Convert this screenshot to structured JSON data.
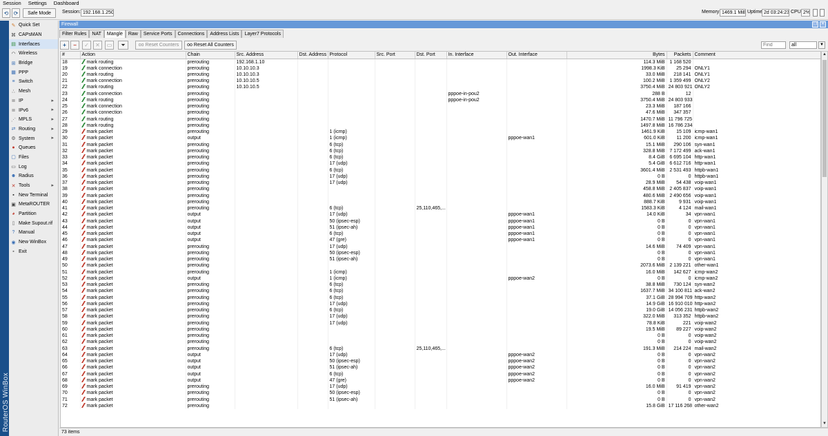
{
  "menubar": {
    "items": [
      "Session",
      "Settings",
      "Dashboard"
    ]
  },
  "toolbar": {
    "safe_mode": "Safe Mode",
    "session_label": "Session:",
    "session_value": "192.168.1.250",
    "memory_label": "Memory:",
    "memory_value": "1469.1 MiB",
    "uptime_label": "Uptime:",
    "uptime_value": "2d 03:24:23",
    "cpu_label": "CPU:",
    "cpu_value": "2%"
  },
  "brand": "RouterOS WinBox",
  "sidebar": {
    "items": [
      {
        "label": "Quick Set",
        "icon": "quickset-icon",
        "glyph": "✎",
        "color": "#d07a2a",
        "submenu": false
      },
      {
        "label": "CAPsMAN",
        "icon": "capsman-icon",
        "glyph": "⌘",
        "color": "#444444",
        "submenu": false
      },
      {
        "label": "Interfaces",
        "icon": "interfaces-icon",
        "glyph": "▤",
        "color": "#2e8b3a",
        "submenu": false
      },
      {
        "label": "Wireless",
        "icon": "wireless-icon",
        "glyph": "◠",
        "color": "#333333",
        "submenu": false
      },
      {
        "label": "Bridge",
        "icon": "bridge-icon",
        "glyph": "⊞",
        "color": "#3a6fb5",
        "submenu": false
      },
      {
        "label": "PPP",
        "icon": "ppp-icon",
        "glyph": "▦",
        "color": "#3a6fb5",
        "submenu": false
      },
      {
        "label": "Switch",
        "icon": "switch-icon",
        "glyph": "≡",
        "color": "#3a6fb5",
        "submenu": false
      },
      {
        "label": "Mesh",
        "icon": "mesh-icon",
        "glyph": "∴",
        "color": "#555555",
        "submenu": false
      },
      {
        "label": "IP",
        "icon": "ip-icon",
        "glyph": "≣",
        "color": "#777777",
        "submenu": true
      },
      {
        "label": "IPv6",
        "icon": "ipv6-icon",
        "glyph": "≣",
        "color": "#777777",
        "submenu": true
      },
      {
        "label": "MPLS",
        "icon": "mpls-icon",
        "glyph": "⋰",
        "color": "#777777",
        "submenu": true
      },
      {
        "label": "Routing",
        "icon": "routing-icon",
        "glyph": "⇄",
        "color": "#3a6fb5",
        "submenu": true
      },
      {
        "label": "System",
        "icon": "system-icon",
        "glyph": "⚙",
        "color": "#555555",
        "submenu": true
      },
      {
        "label": "Queues",
        "icon": "queues-icon",
        "glyph": "●",
        "color": "#c0392b",
        "submenu": false
      },
      {
        "label": "Files",
        "icon": "files-icon",
        "glyph": "▢",
        "color": "#3a6fb5",
        "submenu": false
      },
      {
        "label": "Log",
        "icon": "log-icon",
        "glyph": "▭",
        "color": "#555555",
        "submenu": false
      },
      {
        "label": "Radius",
        "icon": "radius-icon",
        "glyph": "☻",
        "color": "#3a6fb5",
        "submenu": false
      },
      {
        "label": "Tools",
        "icon": "tools-icon",
        "glyph": "✕",
        "color": "#c0392b",
        "submenu": true
      },
      {
        "label": "New Terminal",
        "icon": "terminal-icon",
        "glyph": "▪",
        "color": "#222222",
        "submenu": false
      },
      {
        "label": "MetaROUTER",
        "icon": "metarouter-icon",
        "glyph": "▣",
        "color": "#444444",
        "submenu": false
      },
      {
        "label": "Partition",
        "icon": "partition-icon",
        "glyph": "◕",
        "color": "#c0392b",
        "submenu": false
      },
      {
        "label": "Make Supout.rif",
        "icon": "supout-icon",
        "glyph": "▯",
        "color": "#666666",
        "submenu": false
      },
      {
        "label": "Manual",
        "icon": "manual-icon",
        "glyph": "?",
        "color": "#3a6fb5",
        "submenu": false
      },
      {
        "label": "New WinBox",
        "icon": "winbox-icon",
        "glyph": "◉",
        "color": "#3a6fb5",
        "submenu": false
      },
      {
        "label": "Exit",
        "icon": "exit-icon",
        "glyph": "▪",
        "color": "#666666",
        "submenu": false
      }
    ]
  },
  "window": {
    "title": "Firewall",
    "tabs": [
      "Filter Rules",
      "NAT",
      "Mangle",
      "Raw",
      "Service Ports",
      "Connections",
      "Address Lists",
      "Layer7 Protocols"
    ],
    "active_tab": "Mangle",
    "reset_counters": "Reset Counters",
    "reset_all_counters": "Reset All Counters",
    "find_placeholder": "Find",
    "filter_value": "all",
    "status": "73 items"
  },
  "colors": {
    "title_bar": "#6598d8",
    "mark_routing_icon": "#2e8b3a",
    "mark_packet_icon": "#c0392b"
  },
  "table": {
    "columns": [
      "#",
      "Action",
      "Chain",
      "Src. Address",
      "Dst. Address",
      "Protocol",
      "Src. Port",
      "Dst. Port",
      "In. Interface",
      "Out. Interface",
      "Bytes",
      "Packets",
      "Comment"
    ],
    "rows": [
      [
        "18",
        "mark routing",
        "prerouting",
        "192.168.1.10",
        "",
        "",
        "",
        "",
        "",
        "",
        "114.3 MiB",
        "1 168 520",
        ""
      ],
      [
        "19",
        "mark connection",
        "prerouting",
        "10.10.10.3",
        "",
        "",
        "",
        "",
        "",
        "",
        "1998.3 KiB",
        "25 294",
        "ONLY1"
      ],
      [
        "20",
        "mark routing",
        "prerouting",
        "10.10.10.3",
        "",
        "",
        "",
        "",
        "",
        "",
        "33.0 MiB",
        "218 141",
        "ONLY1"
      ],
      [
        "21",
        "mark connection",
        "prerouting",
        "10.10.10.5",
        "",
        "",
        "",
        "",
        "",
        "",
        "100.2 MiB",
        "1 359 499",
        "ONLY2"
      ],
      [
        "22",
        "mark routing",
        "prerouting",
        "10.10.10.5",
        "",
        "",
        "",
        "",
        "",
        "",
        "3750.4 MiB",
        "24 803 921",
        "ONLY2"
      ],
      [
        "23",
        "mark connection",
        "prerouting",
        "",
        "",
        "",
        "",
        "",
        "pppoe-in-pou2",
        "",
        "288 B",
        "12",
        ""
      ],
      [
        "24",
        "mark routing",
        "prerouting",
        "",
        "",
        "",
        "",
        "",
        "pppoe-in-pou2",
        "",
        "3750.4 MiB",
        "24 803 933",
        ""
      ],
      [
        "25",
        "mark connection",
        "prerouting",
        "",
        "",
        "",
        "",
        "",
        "",
        "",
        "23.3 MiB",
        "187 166",
        ""
      ],
      [
        "26",
        "mark connection",
        "prerouting",
        "",
        "",
        "",
        "",
        "",
        "",
        "",
        "47.6 MiB",
        "347 357",
        ""
      ],
      [
        "27",
        "mark routing",
        "prerouting",
        "",
        "",
        "",
        "",
        "",
        "",
        "",
        "1470.7 MiB",
        "11 796 725",
        ""
      ],
      [
        "28",
        "mark routing",
        "prerouting",
        "",
        "",
        "",
        "",
        "",
        "",
        "",
        "1497.8 MiB",
        "16 786 234",
        ""
      ],
      [
        "29",
        "mark packet",
        "prerouting",
        "",
        "",
        "1 (icmp)",
        "",
        "",
        "",
        "",
        "1461.9 KiB",
        "15 109",
        "icmp-wan1"
      ],
      [
        "30",
        "mark packet",
        "output",
        "",
        "",
        "1 (icmp)",
        "",
        "",
        "",
        "pppoe-wan1",
        "601.0 KiB",
        "11 200",
        "icmp-wan1"
      ],
      [
        "31",
        "mark packet",
        "prerouting",
        "",
        "",
        "6 (tcp)",
        "",
        "",
        "",
        "",
        "15.1 MiB",
        "290 106",
        "syn-wan1"
      ],
      [
        "32",
        "mark packet",
        "prerouting",
        "",
        "",
        "6 (tcp)",
        "",
        "",
        "",
        "",
        "328.8 MiB",
        "7 172 499",
        "ack-wan1"
      ],
      [
        "33",
        "mark packet",
        "prerouting",
        "",
        "",
        "6 (tcp)",
        "",
        "",
        "",
        "",
        "8.4 GiB",
        "6 695 104",
        "http-wan1"
      ],
      [
        "34",
        "mark packet",
        "prerouting",
        "",
        "",
        "17 (udp)",
        "",
        "",
        "",
        "",
        "5.4 GiB",
        "6 612 716",
        "http-wan1"
      ],
      [
        "35",
        "mark packet",
        "prerouting",
        "",
        "",
        "6 (tcp)",
        "",
        "",
        "",
        "",
        "3601.4 MiB",
        "2 531 493",
        "httpb-wan1"
      ],
      [
        "36",
        "mark packet",
        "prerouting",
        "",
        "",
        "17 (udp)",
        "",
        "",
        "",
        "",
        "0 B",
        "0",
        "httpb-wan1"
      ],
      [
        "37",
        "mark packet",
        "prerouting",
        "",
        "",
        "17 (udp)",
        "",
        "",
        "",
        "",
        "28.9 MiB",
        "54 438",
        "voip-wan1"
      ],
      [
        "38",
        "mark packet",
        "prerouting",
        "",
        "",
        "",
        "",
        "",
        "",
        "",
        "458.8 MiB",
        "2 405 837",
        "voip-wan1"
      ],
      [
        "39",
        "mark packet",
        "prerouting",
        "",
        "",
        "",
        "",
        "",
        "",
        "",
        "480.6 MiB",
        "2 490 656",
        "voip-wan1"
      ],
      [
        "40",
        "mark packet",
        "prerouting",
        "",
        "",
        "",
        "",
        "",
        "",
        "",
        "888.7 KiB",
        "9 931",
        "voip-wan1"
      ],
      [
        "41",
        "mark packet",
        "prerouting",
        "",
        "",
        "6 (tcp)",
        "",
        "25,110,465,...",
        "",
        "",
        "1583.3 KiB",
        "4 124",
        "mail-wan1"
      ],
      [
        "42",
        "mark packet",
        "output",
        "",
        "",
        "17 (udp)",
        "",
        "",
        "",
        "pppoe-wan1",
        "14.0 KiB",
        "34",
        "vpn-wan1"
      ],
      [
        "43",
        "mark packet",
        "output",
        "",
        "",
        "50 (ipsec-esp)",
        "",
        "",
        "",
        "pppoe-wan1",
        "0 B",
        "0",
        "vpn-wan1"
      ],
      [
        "44",
        "mark packet",
        "output",
        "",
        "",
        "51 (ipsec-ah)",
        "",
        "",
        "",
        "pppoe-wan1",
        "0 B",
        "0",
        "vpn-wan1"
      ],
      [
        "45",
        "mark packet",
        "output",
        "",
        "",
        "6 (tcp)",
        "",
        "",
        "",
        "pppoe-wan1",
        "0 B",
        "0",
        "vpn-wan1"
      ],
      [
        "46",
        "mark packet",
        "output",
        "",
        "",
        "47 (gre)",
        "",
        "",
        "",
        "pppoe-wan1",
        "0 B",
        "0",
        "vpn-wan1"
      ],
      [
        "47",
        "mark packet",
        "prerouting",
        "",
        "",
        "17 (udp)",
        "",
        "",
        "",
        "",
        "14.6 MiB",
        "74 409",
        "vpn-wan1"
      ],
      [
        "48",
        "mark packet",
        "prerouting",
        "",
        "",
        "50 (ipsec-esp)",
        "",
        "",
        "",
        "",
        "0 B",
        "0",
        "vpn-wan1"
      ],
      [
        "49",
        "mark packet",
        "prerouting",
        "",
        "",
        "51 (ipsec-ah)",
        "",
        "",
        "",
        "",
        "0 B",
        "0",
        "vpn-wan1"
      ],
      [
        "50",
        "mark packet",
        "prerouting",
        "",
        "",
        "",
        "",
        "",
        "",
        "",
        "2073.6 MiB",
        "2 139 221",
        "other-wan1"
      ],
      [
        "51",
        "mark packet",
        "prerouting",
        "",
        "",
        "1 (icmp)",
        "",
        "",
        "",
        "",
        "16.0 MiB",
        "142 627",
        "icmp-wan2"
      ],
      [
        "52",
        "mark packet",
        "output",
        "",
        "",
        "1 (icmp)",
        "",
        "",
        "",
        "pppoe-wan2",
        "0 B",
        "0",
        "icmp-wan2"
      ],
      [
        "53",
        "mark packet",
        "prerouting",
        "",
        "",
        "6 (tcp)",
        "",
        "",
        "",
        "",
        "38.8 MiB",
        "730 124",
        "syn-wan2"
      ],
      [
        "54",
        "mark packet",
        "prerouting",
        "",
        "",
        "6 (tcp)",
        "",
        "",
        "",
        "",
        "1637.7 MiB",
        "34 100 811",
        "ack-wan2"
      ],
      [
        "55",
        "mark packet",
        "prerouting",
        "",
        "",
        "6 (tcp)",
        "",
        "",
        "",
        "",
        "37.1 GiB",
        "28 994 709",
        "http-wan2"
      ],
      [
        "56",
        "mark packet",
        "prerouting",
        "",
        "",
        "17 (udp)",
        "",
        "",
        "",
        "",
        "14.9 GiB",
        "16 910 010",
        "http-wan2"
      ],
      [
        "57",
        "mark packet",
        "prerouting",
        "",
        "",
        "6 (tcp)",
        "",
        "",
        "",
        "",
        "19.0 GiB",
        "14 056 231",
        "httpb-wan2"
      ],
      [
        "58",
        "mark packet",
        "prerouting",
        "",
        "",
        "17 (udp)",
        "",
        "",
        "",
        "",
        "322.0 MiB",
        "313 352",
        "httpb-wan2"
      ],
      [
        "59",
        "mark packet",
        "prerouting",
        "",
        "",
        "17 (udp)",
        "",
        "",
        "",
        "",
        "78.8 KiB",
        "221",
        "voip-wan2"
      ],
      [
        "60",
        "mark packet",
        "prerouting",
        "",
        "",
        "",
        "",
        "",
        "",
        "",
        "19.5 MiB",
        "89 227",
        "voip-wan2"
      ],
      [
        "61",
        "mark packet",
        "prerouting",
        "",
        "",
        "",
        "",
        "",
        "",
        "",
        "0 B",
        "0",
        "voip-wan2"
      ],
      [
        "62",
        "mark packet",
        "prerouting",
        "",
        "",
        "",
        "",
        "",
        "",
        "",
        "0 B",
        "0",
        "voip-wan2"
      ],
      [
        "63",
        "mark packet",
        "prerouting",
        "",
        "",
        "6 (tcp)",
        "",
        "25,110,465,...",
        "",
        "",
        "191.3 MiB",
        "214 224",
        "mail-wan2"
      ],
      [
        "64",
        "mark packet",
        "output",
        "",
        "",
        "17 (udp)",
        "",
        "",
        "",
        "pppoe-wan2",
        "0 B",
        "0",
        "vpn-wan2"
      ],
      [
        "65",
        "mark packet",
        "output",
        "",
        "",
        "50 (ipsec-esp)",
        "",
        "",
        "",
        "pppoe-wan2",
        "0 B",
        "0",
        "vpn-wan2"
      ],
      [
        "66",
        "mark packet",
        "output",
        "",
        "",
        "51 (ipsec-ah)",
        "",
        "",
        "",
        "pppoe-wan2",
        "0 B",
        "0",
        "vpn-wan2"
      ],
      [
        "67",
        "mark packet",
        "output",
        "",
        "",
        "6 (tcp)",
        "",
        "",
        "",
        "pppoe-wan2",
        "0 B",
        "0",
        "vpn-wan2"
      ],
      [
        "68",
        "mark packet",
        "output",
        "",
        "",
        "47 (gre)",
        "",
        "",
        "",
        "pppoe-wan2",
        "0 B",
        "0",
        "vpn-wan2"
      ],
      [
        "69",
        "mark packet",
        "prerouting",
        "",
        "",
        "17 (udp)",
        "",
        "",
        "",
        "",
        "16.0 MiB",
        "91 419",
        "vpn-wan2"
      ],
      [
        "70",
        "mark packet",
        "prerouting",
        "",
        "",
        "50 (ipsec-esp)",
        "",
        "",
        "",
        "",
        "0 B",
        "0",
        "vpn-wan2"
      ],
      [
        "71",
        "mark packet",
        "prerouting",
        "",
        "",
        "51 (ipsec-ah)",
        "",
        "",
        "",
        "",
        "0 B",
        "0",
        "vpn-wan2"
      ],
      [
        "72",
        "mark packet",
        "prerouting",
        "",
        "",
        "",
        "",
        "",
        "",
        "",
        "15.8 GiB",
        "17 116 268",
        "other-wan2"
      ]
    ]
  }
}
